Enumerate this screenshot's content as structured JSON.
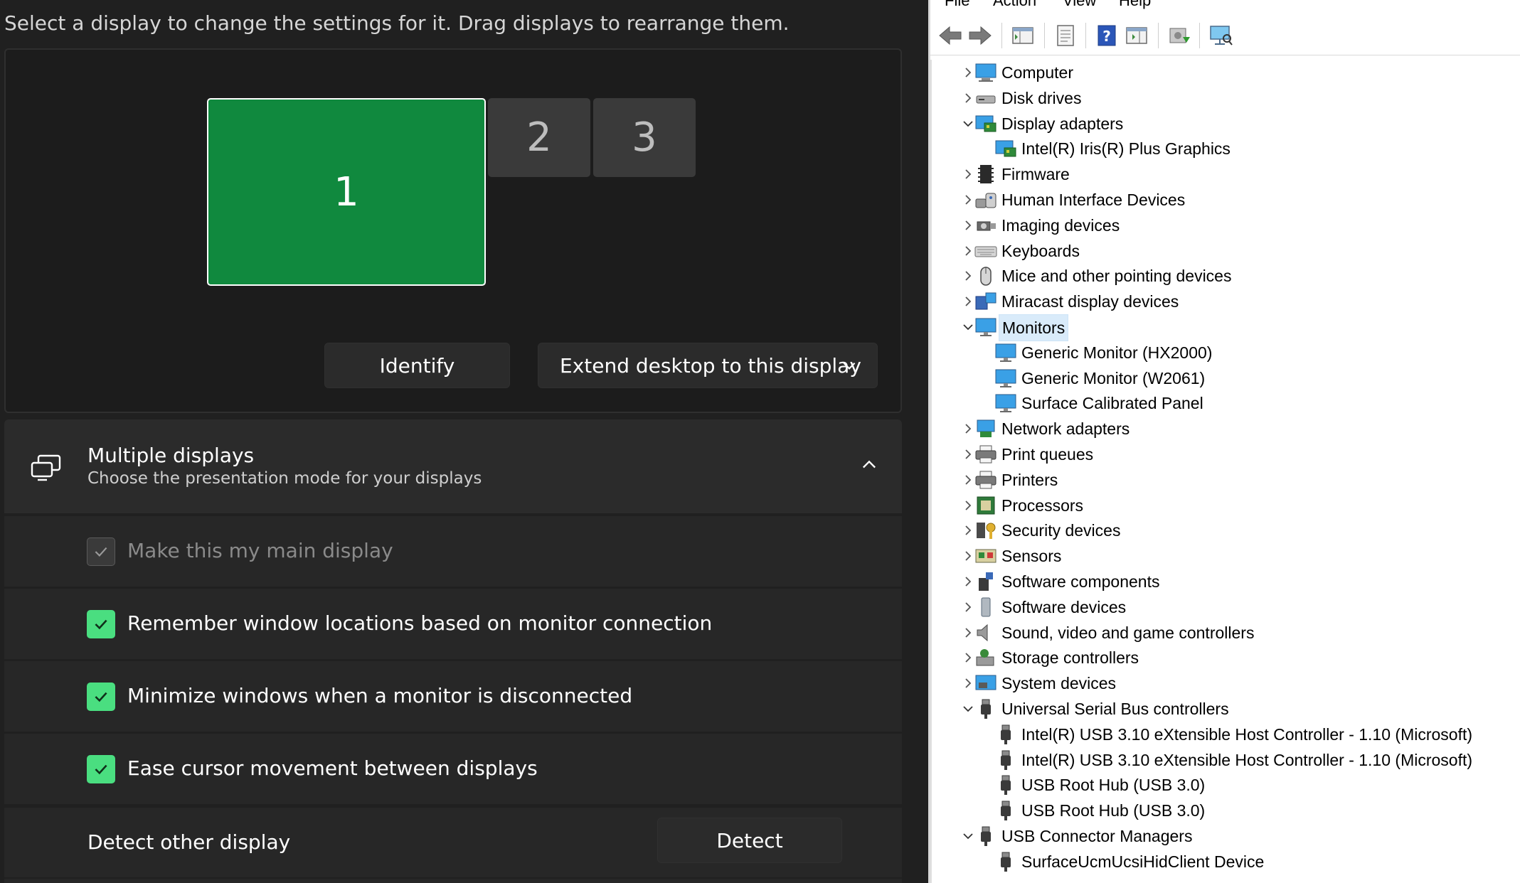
{
  "settings": {
    "instruction": "Select a display to change the settings for it. Drag displays to rearrange them.",
    "monitors": [
      {
        "label": "1",
        "selected": true
      },
      {
        "label": "2",
        "selected": false
      },
      {
        "label": "3",
        "selected": false
      }
    ],
    "identify_label": "Identify",
    "projection_mode": "Extend desktop to this display",
    "multiple_displays": {
      "title": "Multiple displays",
      "subtitle": "Choose the presentation mode for your displays",
      "expanded": true
    },
    "options": [
      {
        "label": "Make this my main display",
        "checked": true,
        "disabled": true
      },
      {
        "label": "Remember window locations based on monitor connection",
        "checked": true,
        "disabled": false
      },
      {
        "label": "Minimize windows when a monitor is disconnected",
        "checked": true,
        "disabled": false
      },
      {
        "label": "Ease cursor movement between displays",
        "checked": true,
        "disabled": false
      }
    ],
    "detect": {
      "label": "Detect other display",
      "button": "Detect"
    },
    "colors": {
      "accent": "#10893e",
      "checkbox": "#4ade80",
      "background": "#202020",
      "card": "#2b2b2b"
    }
  },
  "device_manager": {
    "menu": [
      "File",
      "Action",
      "View",
      "Help"
    ],
    "toolbar_icons": [
      "back-arrow-icon",
      "forward-arrow-icon",
      "show-hide-tree-icon",
      "properties-icon",
      "help-icon",
      "action-pane-icon",
      "update-driver-icon",
      "scan-hardware-icon"
    ],
    "tree": [
      {
        "label": "Computer",
        "level": 0,
        "expanded": false,
        "icon": "computer-icon"
      },
      {
        "label": "Disk drives",
        "level": 0,
        "expanded": false,
        "icon": "disk-drive-icon"
      },
      {
        "label": "Display adapters",
        "level": 0,
        "expanded": true,
        "icon": "display-adapter-icon"
      },
      {
        "label": "Intel(R) Iris(R) Plus Graphics",
        "level": 1,
        "icon": "display-adapter-icon"
      },
      {
        "label": "Firmware",
        "level": 0,
        "expanded": false,
        "icon": "firmware-icon"
      },
      {
        "label": "Human Interface Devices",
        "level": 0,
        "expanded": false,
        "icon": "hid-icon"
      },
      {
        "label": "Imaging devices",
        "level": 0,
        "expanded": false,
        "icon": "camera-icon"
      },
      {
        "label": "Keyboards",
        "level": 0,
        "expanded": false,
        "icon": "keyboard-icon"
      },
      {
        "label": "Mice and other pointing devices",
        "level": 0,
        "expanded": false,
        "icon": "mouse-icon"
      },
      {
        "label": "Miracast display devices",
        "level": 0,
        "expanded": false,
        "icon": "miracast-icon"
      },
      {
        "label": "Monitors",
        "level": 0,
        "expanded": true,
        "selected": true,
        "icon": "monitor-icon"
      },
      {
        "label": "Generic Monitor (HX2000)",
        "level": 1,
        "icon": "monitor-icon"
      },
      {
        "label": "Generic Monitor (W2061)",
        "level": 1,
        "icon": "monitor-icon"
      },
      {
        "label": "Surface Calibrated Panel",
        "level": 1,
        "icon": "monitor-icon"
      },
      {
        "label": "Network adapters",
        "level": 0,
        "expanded": false,
        "icon": "network-icon"
      },
      {
        "label": "Print queues",
        "level": 0,
        "expanded": false,
        "icon": "printer-icon"
      },
      {
        "label": "Printers",
        "level": 0,
        "expanded": false,
        "icon": "printer-icon"
      },
      {
        "label": "Processors",
        "level": 0,
        "expanded": false,
        "icon": "processor-icon"
      },
      {
        "label": "Security devices",
        "level": 0,
        "expanded": false,
        "icon": "security-icon"
      },
      {
        "label": "Sensors",
        "level": 0,
        "expanded": false,
        "icon": "sensor-icon"
      },
      {
        "label": "Software components",
        "level": 0,
        "expanded": false,
        "icon": "software-component-icon"
      },
      {
        "label": "Software devices",
        "level": 0,
        "expanded": false,
        "icon": "software-device-icon"
      },
      {
        "label": "Sound, video and game controllers",
        "level": 0,
        "expanded": false,
        "icon": "speaker-icon"
      },
      {
        "label": "Storage controllers",
        "level": 0,
        "expanded": false,
        "icon": "storage-icon"
      },
      {
        "label": "System devices",
        "level": 0,
        "expanded": false,
        "icon": "system-icon"
      },
      {
        "label": "Universal Serial Bus controllers",
        "level": 0,
        "expanded": true,
        "icon": "usb-icon"
      },
      {
        "label": "Intel(R) USB 3.10 eXtensible Host Controller - 1.10 (Microsoft)",
        "level": 1,
        "icon": "usb-icon"
      },
      {
        "label": "Intel(R) USB 3.10 eXtensible Host Controller - 1.10 (Microsoft)",
        "level": 1,
        "icon": "usb-icon"
      },
      {
        "label": "USB Root Hub (USB 3.0)",
        "level": 1,
        "icon": "usb-icon"
      },
      {
        "label": "USB Root Hub (USB 3.0)",
        "level": 1,
        "icon": "usb-icon"
      },
      {
        "label": "USB Connector Managers",
        "level": 0,
        "expanded": true,
        "icon": "usb-icon"
      },
      {
        "label": "SurfaceUcmUcsiHidClient Device",
        "level": 1,
        "icon": "usb-icon"
      }
    ]
  }
}
